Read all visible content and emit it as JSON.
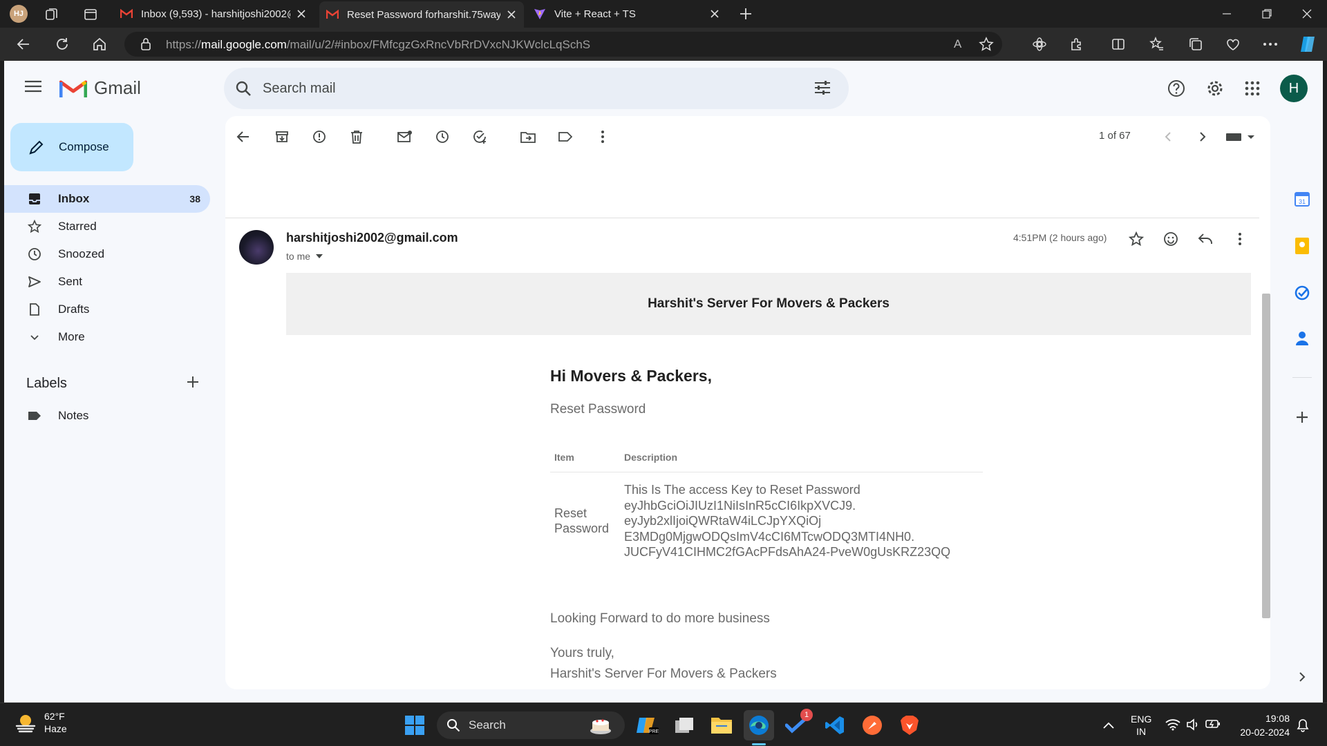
{
  "browser": {
    "profile_initials": "HJ",
    "tabs": [
      {
        "label": "Inbox (9,593) - harshitjoshi2002@"
      },
      {
        "label": "Reset Password forharshit.75way"
      },
      {
        "label": "Vite + React + TS"
      }
    ],
    "url_prefix": "https://",
    "url_host": "mail.google.com",
    "url_path": "/mail/u/2/#inbox/FMfcgzGxRncVbRrDVxcNJKWclcLqSchS"
  },
  "gmail": {
    "logo_text": "Gmail",
    "search_placeholder": "Search mail",
    "avatar_letter": "H",
    "compose_label": "Compose",
    "nav": [
      {
        "label": "Inbox",
        "count": "38",
        "icon": "inbox-icon"
      },
      {
        "label": "Starred",
        "count": "",
        "icon": "star-icon"
      },
      {
        "label": "Snoozed",
        "count": "",
        "icon": "clock-icon"
      },
      {
        "label": "Sent",
        "count": "",
        "icon": "send-icon"
      },
      {
        "label": "Drafts",
        "count": "",
        "icon": "draft-icon"
      },
      {
        "label": "More",
        "count": "",
        "icon": "chevron-down-icon"
      }
    ],
    "labels_heading": "Labels",
    "labels": [
      {
        "label": "Notes"
      }
    ],
    "pagination": "1 of 67"
  },
  "message": {
    "sender": "harshitjoshi2002@gmail.com",
    "to": "to me",
    "time": "4:51PM (2 hours ago)",
    "banner_title": "Harshit's Server For Movers & Packers",
    "greeting": "Hi Movers & Packers,",
    "subtitle": "Reset Password",
    "table": {
      "col_item": "Item",
      "col_desc": "Description",
      "row_item_line1": "Reset",
      "row_item_line2": "Password",
      "desc_lines": [
        "This Is The access Key to Reset Password",
        "eyJhbGciOiJIUzI1NiIsInR5cCI6IkpXVCJ9.",
        "eyJyb2xlIjoiQWRtaW4iLCJpYXQiOj",
        "E3MDg0MjgwODQsImV4cCI6MTcwODQ3MTI4NH0.",
        "JUCFyV41CIHMC2fGAcPFdsAhA24-PveW0gUsKRZ23QQ"
      ]
    },
    "closing": "Looking Forward to do more business",
    "signoff": "Yours truly,",
    "signature": "Harshit's Server For Movers & Packers"
  },
  "taskbar": {
    "temp": "62°F",
    "weather": "Haze",
    "search_label": "Search",
    "lang": "ENG",
    "region": "IN",
    "time": "19:08",
    "date": "20-02-2024",
    "vscode_badge": "1"
  },
  "colors": {
    "gmail_bg": "#f6f8fc",
    "compose_bg": "#c2e7ff",
    "selected_nav": "#d3e3fd",
    "banner_bg": "#f0f0f0"
  }
}
